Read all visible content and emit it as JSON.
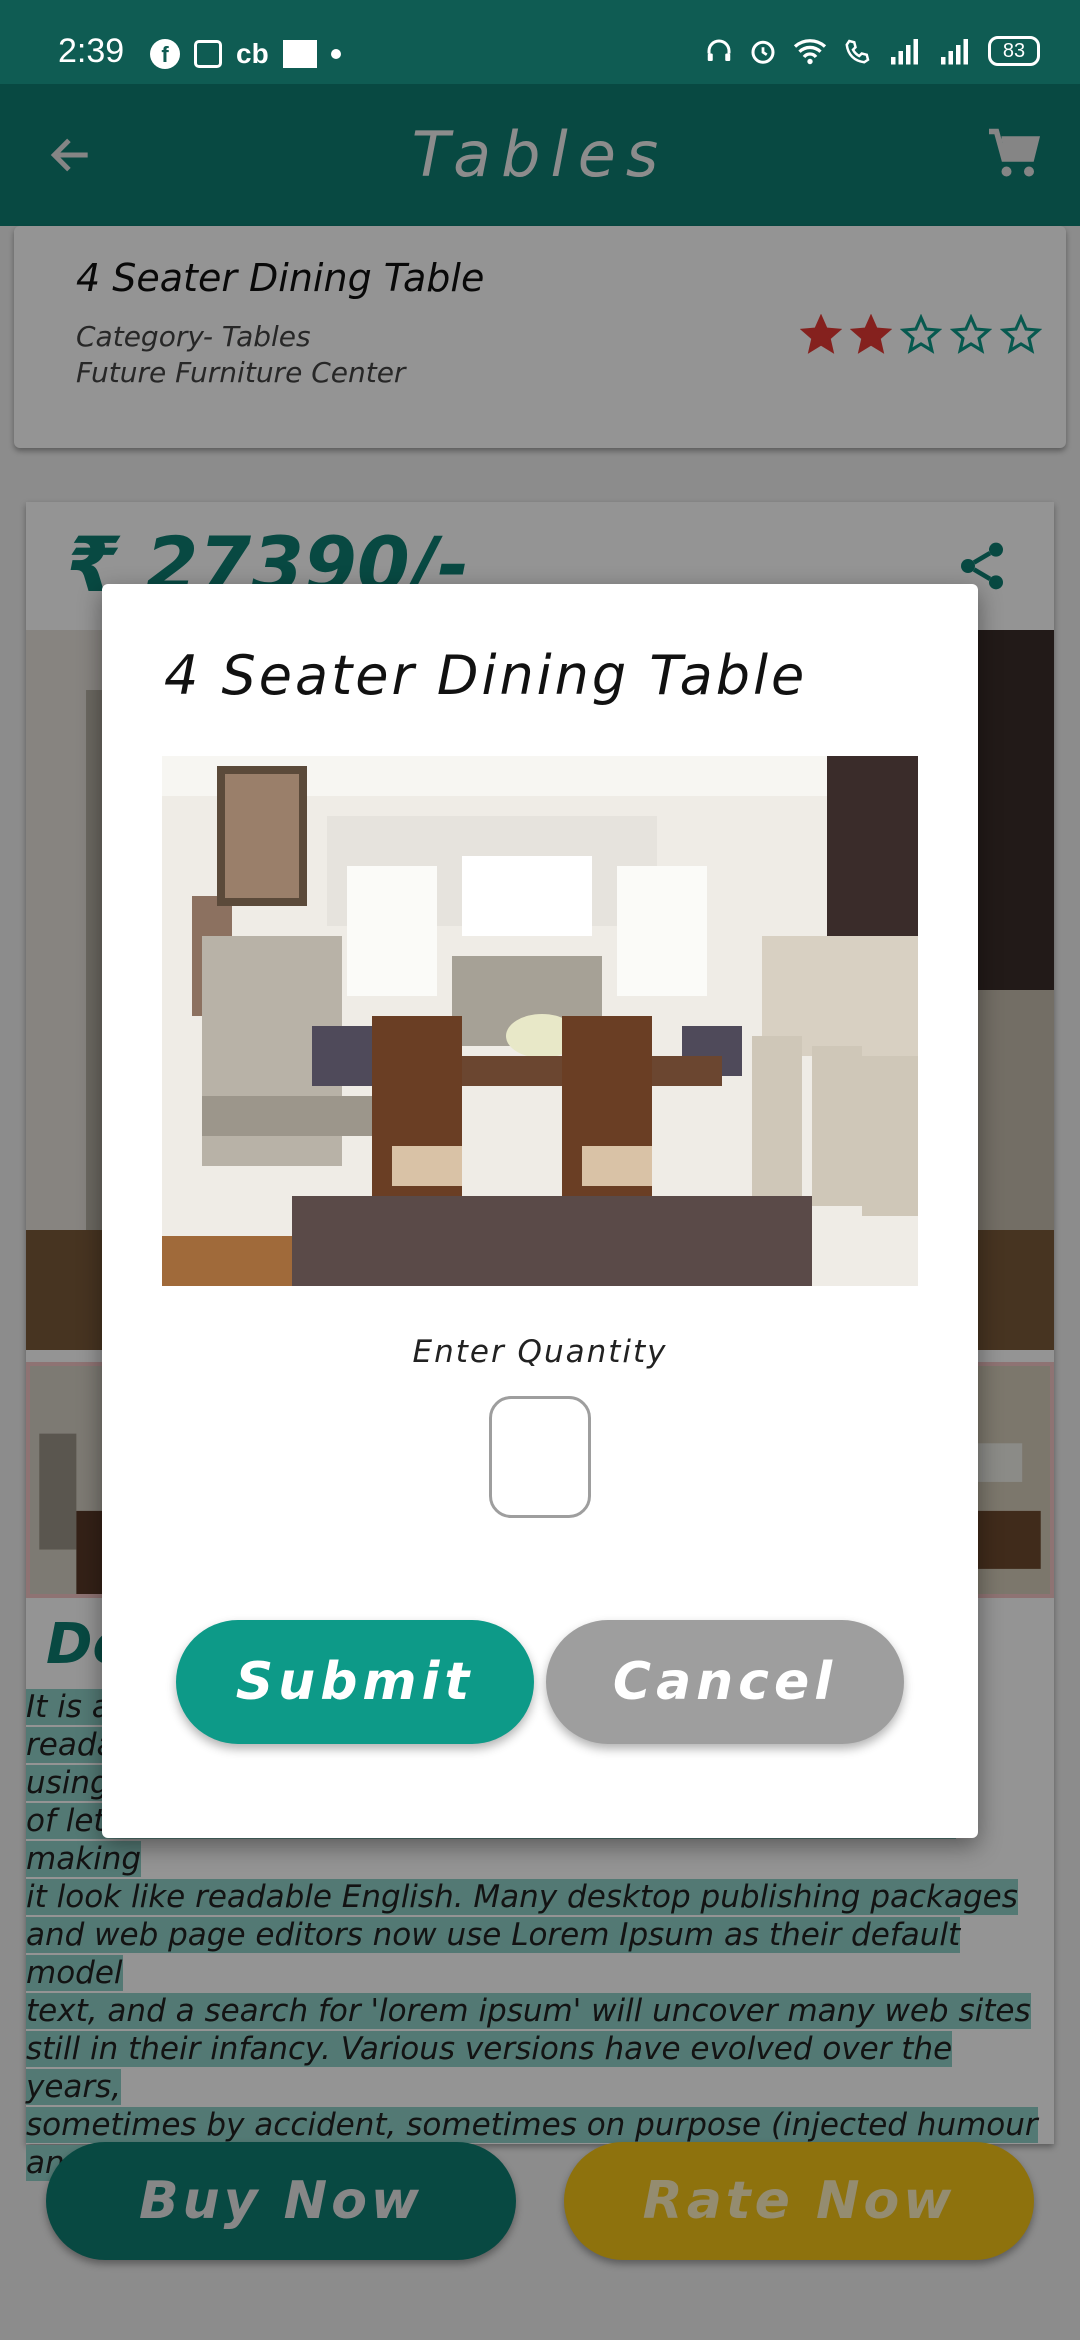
{
  "status_bar": {
    "time": "2:39",
    "battery": "83"
  },
  "app_bar": {
    "title": "Tables"
  },
  "product_header": {
    "title": "4 Seater Dining Table",
    "category": "Category- Tables",
    "store": "Future Furniture Center",
    "rating_filled": 2,
    "rating_max": 5
  },
  "product": {
    "price": "₹ 27390/-",
    "description_heading": "De",
    "description_lines": [
      "It is a",
      "reada",
      "using",
      "of letters, as opposed to using 'Content here, content here', making",
      "it look like readable English. Many desktop publishing packages",
      "and web page editors now use Lorem Ipsum as their default model",
      "text, and a search for 'lorem ipsum' will uncover many web sites",
      "still in their infancy. Various versions have evolved over the years,",
      "sometimes by accident, sometimes on purpose (injected humour",
      "and the like)."
    ]
  },
  "bottom_actions": {
    "buy_label": "Buy Now",
    "rate_label": "Rate Now"
  },
  "dialog": {
    "title": "4 Seater Dining Table",
    "quantity_label": "Enter Quantity",
    "quantity_value": "",
    "submit_label": "Submit",
    "cancel_label": "Cancel"
  },
  "colors": {
    "primary": "#0f7f73",
    "status_bar": "#0f5c53",
    "submit": "#0d9a88",
    "cancel": "#9e9e9e",
    "rate": "#f5c518",
    "star_filled": "#e53935",
    "star_empty": "#0d9a88"
  },
  "icons": [
    "back-arrow-icon",
    "cart-icon",
    "share-icon",
    "star-icon",
    "wifi-icon",
    "signal-icon",
    "alarm-icon",
    "headset-icon"
  ]
}
